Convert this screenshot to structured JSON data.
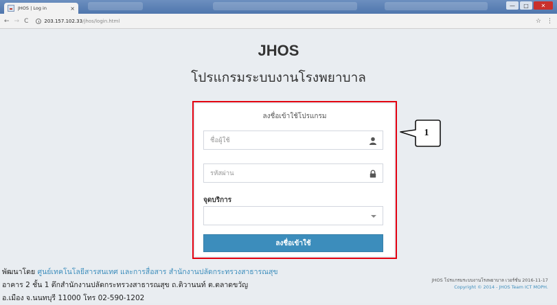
{
  "browser": {
    "tab_title": "JHOS | Log in",
    "tab_close": "×",
    "address_host": "203.157.102.33",
    "address_path": "/jhos/login.html",
    "back": "←",
    "forward": "→",
    "reload": "C",
    "star": "☆",
    "menu": "⋮",
    "minimize": "—",
    "maximize": "□",
    "close": "✕"
  },
  "page": {
    "title": "JHOS",
    "subtitle": "โปรแกรมระบบงานโรงพยาบาล"
  },
  "login": {
    "heading": "ลงชื่อเข้าใช้โปรแกรม",
    "username_placeholder": "ชื่อผู้ใช้",
    "username_value": "",
    "password_placeholder": "รหัสผ่าน",
    "password_value": "",
    "service_point_label": "จุดบริการ",
    "service_point_value": "",
    "submit_label": "ลงชื่อเข้าใช้"
  },
  "callout": {
    "number": "1"
  },
  "footer": {
    "developed_by": "พัฒนาโดย ",
    "developer_link": "ศูนย์เทคโนโลยีสารสนเทศ และการสื่อสาร สำนักงานปลัดกระทรวงสาธารณสุข",
    "address_line1": "อาคาร 2 ชั้น 1 ตึกสำนักงานปลัดกระทรวงสาธารณสุข ถ.ติวานนท์ ต.ตลาดขวัญ",
    "address_line2": "อ.เมือง จ.นนทบุรี 11000 โทร 02-590-1202",
    "version": "JHOS โปรแกรมระบบงานโรงพยาบาล เวอร์ชั่น 2016-11-17",
    "copyright": "Copyright © 2014 - JHOS Team ICT MOPH."
  },
  "colors": {
    "accent_blue": "#3c8dbc",
    "highlight_red": "#e3000f",
    "page_bg": "#e9edf1"
  },
  "icons": {
    "username": "user-icon",
    "password": "lock-icon",
    "select": "caret-down-icon"
  }
}
